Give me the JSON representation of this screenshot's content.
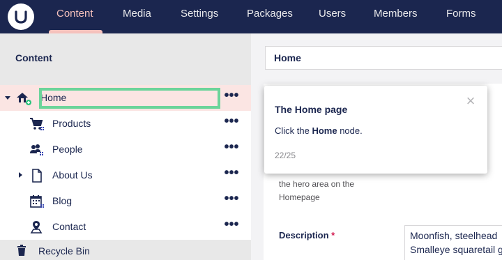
{
  "topbar": {
    "logo_letter": "U",
    "sections": [
      {
        "label": "Content",
        "active": true
      },
      {
        "label": "Media",
        "active": false
      },
      {
        "label": "Settings",
        "active": false
      },
      {
        "label": "Packages",
        "active": false
      },
      {
        "label": "Users",
        "active": false
      },
      {
        "label": "Members",
        "active": false
      },
      {
        "label": "Forms",
        "active": false
      }
    ]
  },
  "tree": {
    "title": "Content",
    "items": [
      {
        "label": "Home",
        "icon": "home-icon",
        "selected": true,
        "expander": "open"
      },
      {
        "label": "Products",
        "icon": "shopping-cart-icon",
        "selected": false,
        "expander": "none"
      },
      {
        "label": "People",
        "icon": "people-icon",
        "selected": false,
        "expander": "none"
      },
      {
        "label": "About Us",
        "icon": "document-icon",
        "selected": false,
        "expander": "closed"
      },
      {
        "label": "Blog",
        "icon": "calendar-icon",
        "selected": false,
        "expander": "none"
      },
      {
        "label": "Contact",
        "icon": "map-pin-icon",
        "selected": false,
        "expander": "none"
      }
    ],
    "actions_glyph": "•••",
    "recycle_bin": "Recycle Bin"
  },
  "editor": {
    "node_name": "Home",
    "hero_text": "the hero area on the Homepage",
    "description_label": "Description",
    "description_required": "*",
    "description_lines": [
      "Moonfish, steelhead",
      "Smalleye squaretail g"
    ]
  },
  "tour": {
    "title": "The Home page",
    "body_prefix": "Click the ",
    "body_bold": "Home",
    "body_suffix": " node.",
    "steps": "22/25",
    "close_glyph": "×"
  },
  "colors": {
    "nav_bg": "#1b264f",
    "nav_active": "#f5c1bc",
    "selected_row": "#fbe5e3",
    "highlight_border": "#6cd49a",
    "required": "#d42054"
  }
}
